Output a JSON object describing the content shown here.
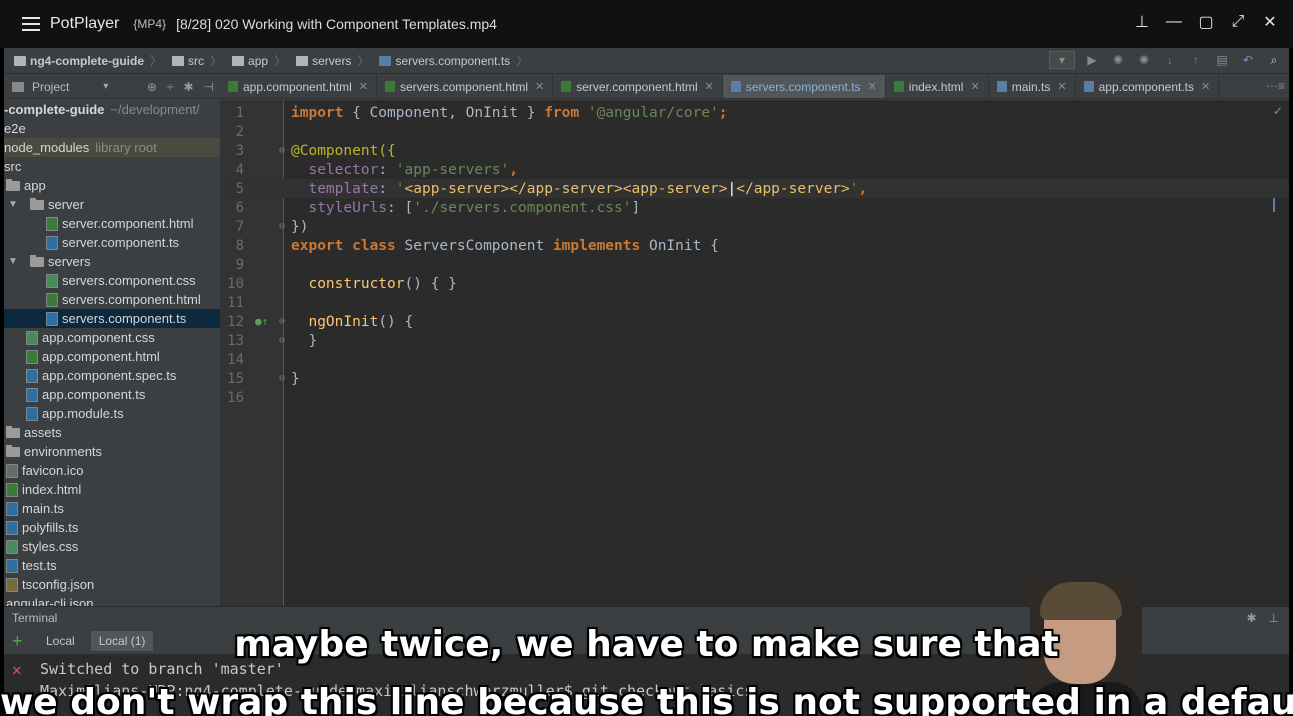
{
  "player": {
    "app_name": "PotPlayer",
    "format": "{MP4}",
    "file_title": "[8/28] 020 Working with Component Templates.mp4",
    "controls": [
      "pin-icon",
      "minimize-icon",
      "maximize-icon",
      "fullscreen-icon",
      "close-icon"
    ]
  },
  "breadcrumb": [
    {
      "label": "ng4-complete-guide",
      "icon": "folder-icon"
    },
    {
      "label": "src",
      "icon": "folder-icon"
    },
    {
      "label": "app",
      "icon": "folder-icon"
    },
    {
      "label": "servers",
      "icon": "folder-icon"
    },
    {
      "label": "servers.component.ts",
      "icon": "ts-file-icon"
    }
  ],
  "project_panel": {
    "label": "Project"
  },
  "tabs": [
    {
      "label": "app.component.html",
      "active": false
    },
    {
      "label": "servers.component.html",
      "active": false
    },
    {
      "label": "server.component.html",
      "active": false
    },
    {
      "label": "servers.component.ts",
      "active": true
    },
    {
      "label": "index.html",
      "active": false
    },
    {
      "label": "main.ts",
      "active": false
    },
    {
      "label": "app.component.ts",
      "active": false
    }
  ],
  "tree": [
    {
      "label": "-complete-guide",
      "extra": "~/development/",
      "type": "root"
    },
    {
      "label": "e2e",
      "type": "plain"
    },
    {
      "label": "node_modules",
      "extra": "library root",
      "type": "plain"
    },
    {
      "label": "src",
      "type": "plain"
    },
    {
      "label": "app",
      "type": "folder"
    },
    {
      "label": "server",
      "type": "folder"
    },
    {
      "label": "server.component.html",
      "type": "html"
    },
    {
      "label": "server.component.ts",
      "type": "ts"
    },
    {
      "label": "servers",
      "type": "folder"
    },
    {
      "label": "servers.component.css",
      "type": "css"
    },
    {
      "label": "servers.component.html",
      "type": "html"
    },
    {
      "label": "servers.component.ts",
      "type": "ts"
    },
    {
      "label": "app.component.css",
      "type": "css"
    },
    {
      "label": "app.component.html",
      "type": "html"
    },
    {
      "label": "app.component.spec.ts",
      "type": "ts"
    },
    {
      "label": "app.component.ts",
      "type": "ts"
    },
    {
      "label": "app.module.ts",
      "type": "ts"
    },
    {
      "label": "assets",
      "type": "folder"
    },
    {
      "label": "environments",
      "type": "folder"
    },
    {
      "label": "favicon.ico",
      "type": "ico"
    },
    {
      "label": "index.html",
      "type": "html"
    },
    {
      "label": "main.ts",
      "type": "ts"
    },
    {
      "label": "polyfills.ts",
      "type": "ts"
    },
    {
      "label": "styles.css",
      "type": "css"
    },
    {
      "label": "test.ts",
      "type": "ts"
    },
    {
      "label": "tsconfig.json",
      "type": "json"
    },
    {
      "label": "angular-cli.json",
      "type": "plain"
    }
  ],
  "code": {
    "line_numbers": [
      "1",
      "2",
      "3",
      "4",
      "5",
      "6",
      "7",
      "8",
      "9",
      "10",
      "11",
      "12",
      "13",
      "14",
      "15",
      "16"
    ],
    "l1_import": "import",
    "l1_a": " { Component, OnInit } ",
    "l1_from": "from",
    "l1_str": " '@angular/core'",
    "l1_semi": ";",
    "l3": "@Component({",
    "l4_prop": "selector",
    "l4_colon": ": ",
    "l4_str": "'app-servers'",
    "l4_comma": ",",
    "l5_prop": "template",
    "l5_colon": ": ",
    "l5_q1": "'",
    "l5_tpl1": "<app-server></app-server><app-server>",
    "l5_tpl2": "</app-server>",
    "l5_q2": "'",
    "l5_comma": ",",
    "l6_prop": "styleUrls",
    "l6_a": ": [",
    "l6_str": "'./servers.component.css'",
    "l6_b": "]",
    "l7": "})",
    "l8_export": "export",
    "l8_class": " class",
    "l8_name": " ServersComponent ",
    "l8_impl": "implements",
    "l8_rest": " OnInit {",
    "l10_fn": "constructor",
    "l10_rest": "() { }",
    "l12_fn": "ngOnInit",
    "l12_rest": "() {",
    "l13": "}",
    "l15": "}"
  },
  "terminal": {
    "label": "Terminal",
    "tabs": [
      "Local",
      "Local (1)"
    ],
    "line1": "Switched to branch 'master'",
    "line2": "Maximilians-MBP:ng4-complete-guide maximilianschwarzmuller$ git checkout basics"
  },
  "subtitles": {
    "line1": "maybe twice, we have to make sure that",
    "line2": "we don't wrap this line because this is not supported in a default"
  }
}
